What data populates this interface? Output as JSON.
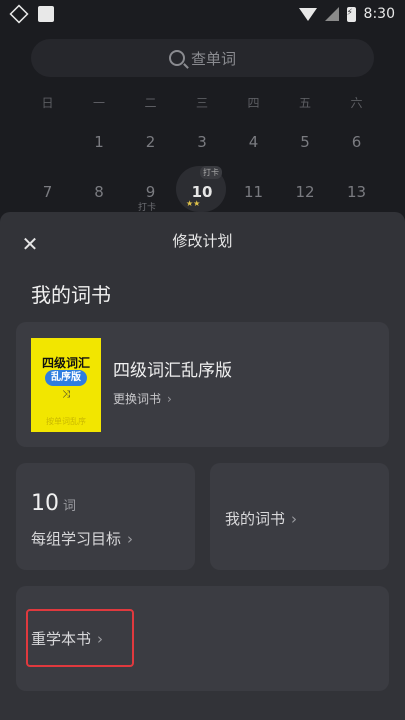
{
  "status_bar": {
    "time": "8:30"
  },
  "search": {
    "placeholder": "查单词"
  },
  "calendar": {
    "weekdays": [
      "日",
      "一",
      "二",
      "三",
      "四",
      "五",
      "六"
    ],
    "row1": [
      "",
      "1",
      "2",
      "3",
      "4",
      "5",
      "6"
    ],
    "row2": [
      "7",
      "8",
      "9",
      "10",
      "11",
      "12",
      "13"
    ],
    "today_badge": "打卡",
    "stars": "★★",
    "punched_label": "打卡"
  },
  "sheet": {
    "title": "修改计划",
    "section_title": "我的词书",
    "book": {
      "cover_title": "四级词汇",
      "cover_tag": "乱序版",
      "cover_shuffle": "⤨",
      "cover_foot": "按单词乱序",
      "name": "四级词汇乱序版",
      "change_label": "更换词书"
    },
    "goal": {
      "number": "10",
      "unit": "词",
      "label": "每组学习目标"
    },
    "my_books_label": "我的词书",
    "restart_label": "重学本书"
  }
}
